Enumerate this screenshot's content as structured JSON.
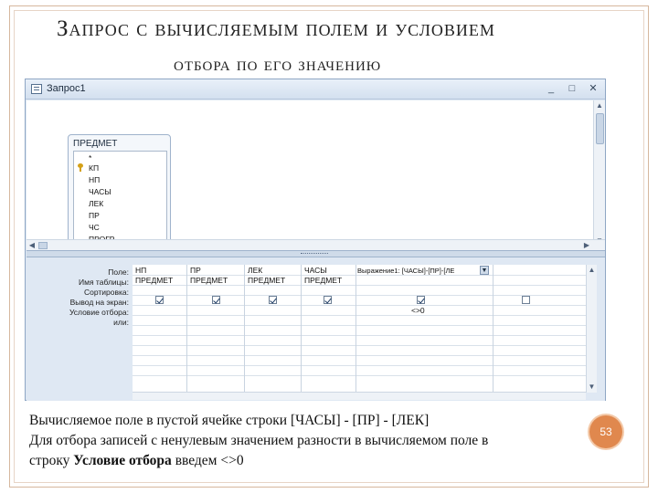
{
  "slide": {
    "title_line1": "Запрос с вычисляемым полем и условием",
    "title_line2": "отбора по его значению",
    "page_number": "53",
    "caption": {
      "line1": "Вычисляемое поле в пустой ячейке строки  [ЧАСЫ] - [ПР] - [ЛЕК]",
      "line2": "Для отбора записей с ненулевым значением разности в вычисляемом поле в",
      "line3_prefix": "строку ",
      "line3_bold": "Условие отбора",
      "line3_suffix": " введем <>0"
    }
  },
  "window": {
    "title": "Запрос1",
    "buttons": {
      "minimize": "_",
      "maximize": "□",
      "close": "✕"
    },
    "table": {
      "name": "ПРЕДМЕТ",
      "fields": [
        "*",
        "КП",
        "НП",
        "ЧАСЫ",
        "ЛЕК",
        "ПР",
        "ЧС",
        "ПРОГР"
      ],
      "key_field": "КП"
    },
    "grid": {
      "row_labels": [
        "Поле:",
        "Имя таблицы:",
        "Сортировка:",
        "Вывод на экран:",
        "Условие отбора:",
        "или:"
      ],
      "columns": [
        {
          "field": "НП",
          "table": "ПРЕДМЕТ",
          "show": true,
          "criteria": ""
        },
        {
          "field": "ПР",
          "table": "ПРЕДМЕТ",
          "show": true,
          "criteria": ""
        },
        {
          "field": "ЛЕК",
          "table": "ПРЕДМЕТ",
          "show": true,
          "criteria": ""
        },
        {
          "field": "ЧАСЫ",
          "table": "ПРЕДМЕТ",
          "show": true,
          "criteria": ""
        },
        {
          "field": "Выражение1: [ЧАСЫ]-[ПР]-[ЛЕ",
          "table": "",
          "show": true,
          "criteria": "<>0"
        },
        {
          "field": "",
          "table": "",
          "show": false,
          "criteria": ""
        }
      ]
    }
  }
}
